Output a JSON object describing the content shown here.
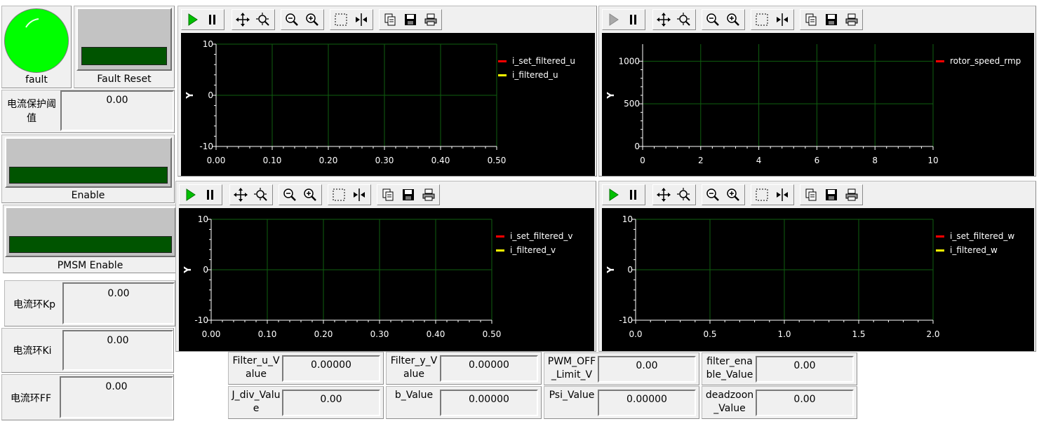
{
  "fault": {
    "label": "fault",
    "color": "#00ff00"
  },
  "fault_reset": {
    "label": "Fault Reset",
    "color": "#005400"
  },
  "current_protect": {
    "label": "电流保护阈值",
    "value": "0.00"
  },
  "enable": {
    "label": "Enable"
  },
  "pmsm_enable": {
    "label": "PMSM Enable"
  },
  "kp": {
    "label": "电流环Kp",
    "value": "0.00"
  },
  "ki": {
    "label": "电流环Ki",
    "value": "0.00"
  },
  "ff": {
    "label": "电流环FF",
    "value": "0.00"
  },
  "toolbar_icons": [
    "play-icon",
    "pause-icon",
    "pan-icon",
    "zoom-area-icon",
    "zoom-out-icon",
    "zoom-in-icon",
    "select-box-icon",
    "cursor-icon",
    "copy-icon",
    "save-icon",
    "print-icon"
  ],
  "charts": [
    {
      "id": "chart-u",
      "ylabel": "Y",
      "xlim": [
        0,
        0.5
      ],
      "ylim": [
        -10,
        10
      ],
      "xticks": [
        "0.00",
        "0.10",
        "0.20",
        "0.30",
        "0.40",
        "0.50"
      ],
      "yticks": [
        "-10",
        "0",
        "10"
      ],
      "legend": [
        {
          "name": "i_set_filtered_u",
          "color": "#ff0000"
        },
        {
          "name": "i_filtered_u",
          "color": "#ffff00"
        }
      ]
    },
    {
      "id": "chart-speed",
      "ylabel": "Y",
      "xlim": [
        0,
        10
      ],
      "ylim": [
        0,
        1200
      ],
      "xticks": [
        "0",
        "2",
        "4",
        "6",
        "8",
        "10"
      ],
      "yticks": [
        "0",
        "500",
        "1000"
      ],
      "legend": [
        {
          "name": "rotor_speed_rmp",
          "color": "#ff0000"
        }
      ]
    },
    {
      "id": "chart-v",
      "ylabel": "Y",
      "xlim": [
        0,
        0.5
      ],
      "ylim": [
        -10,
        10
      ],
      "xticks": [
        "0.00",
        "0.10",
        "0.20",
        "0.30",
        "0.40",
        "0.50"
      ],
      "yticks": [
        "-10",
        "0",
        "10"
      ],
      "legend": [
        {
          "name": "i_set_filtered_v",
          "color": "#ff0000"
        },
        {
          "name": "i_filtered_v",
          "color": "#ffff00"
        }
      ]
    },
    {
      "id": "chart-w",
      "ylabel": "Y",
      "xlim": [
        0,
        2
      ],
      "ylim": [
        -10,
        10
      ],
      "xticks": [
        "0.0",
        "0.5",
        "1.0",
        "1.5",
        "2.0"
      ],
      "yticks": [
        "-10",
        "0",
        "10"
      ],
      "legend": [
        {
          "name": "i_set_filtered_w",
          "color": "#ff0000"
        },
        {
          "name": "i_filtered_w",
          "color": "#ffff00"
        }
      ]
    }
  ],
  "bottom": [
    {
      "label": "Filter_u_Value",
      "value": "0.00000"
    },
    {
      "label": "Filter_y_Value",
      "value": "0.00000"
    },
    {
      "label": "PWM_OFF_Limit_V",
      "value": "0.00"
    },
    {
      "label": "filter_enable_Value",
      "value": "0.00"
    },
    {
      "label": "J_div_Value",
      "value": "0.00"
    },
    {
      "label": "b_Value",
      "value": "0.00000"
    },
    {
      "label": "Psi_Value",
      "value": "0.00000"
    },
    {
      "label": "deadzoon_Value",
      "value": "0.00"
    }
  ]
}
